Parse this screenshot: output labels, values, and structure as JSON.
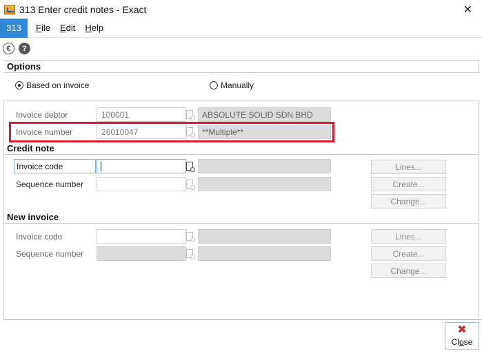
{
  "window": {
    "title": "313 Enter credit notes - Exact"
  },
  "menu": {
    "badge": "313",
    "items": [
      {
        "key": "F",
        "rest": "ile"
      },
      {
        "key": "E",
        "rest": "dit"
      },
      {
        "key": "H",
        "rest": "elp"
      }
    ]
  },
  "toolbar": {
    "currency_symbol": "€",
    "help_symbol": "?"
  },
  "options": {
    "heading": "Options",
    "radio_based": "Based on invoice",
    "radio_manual": "Manually",
    "selected": "Based on invoice"
  },
  "invoice": {
    "debtor_label": "Invoice debtor",
    "debtor_value": "100001",
    "debtor_name": "ABSOLUTE SOLID SDN BHD",
    "number_label": "Invoice number",
    "number_value": "26010047",
    "number_desc": "**Multiple**"
  },
  "credit_note": {
    "heading": "Credit note",
    "code_label": "Invoice code",
    "code_value": "",
    "seq_label": "Sequence number",
    "seq_value": "",
    "btn_lines": "Lines...",
    "btn_create": "Create...",
    "btn_change": "Change..."
  },
  "new_invoice": {
    "heading": "New invoice",
    "code_label": "Invoice code",
    "seq_label": "Sequence number",
    "btn_lines": "Lines...",
    "btn_create": "Create...",
    "btn_change": "Change..."
  },
  "footer": {
    "close_label": "Close",
    "close_key": "o"
  },
  "colors": {
    "accent": "#2f88d8",
    "highlight": "#d81e2c",
    "close_icon": "#c8282c"
  }
}
